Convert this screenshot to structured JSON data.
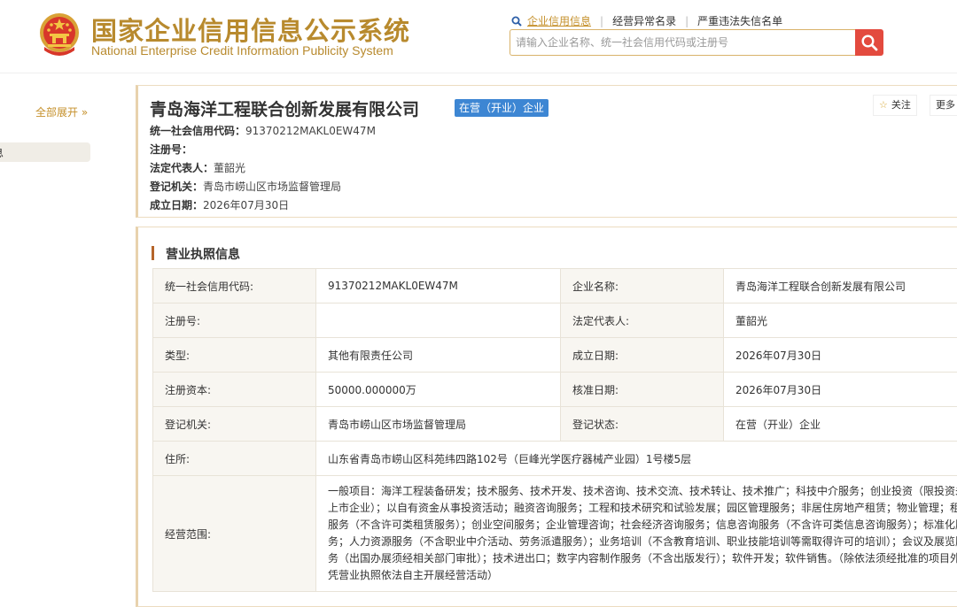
{
  "header": {
    "logo_cn": "国家企业信用信息公示系统",
    "logo_en": "National Enterprise Credit Information Publicity System",
    "links": [
      "企业信用信息",
      "经营异常名录",
      "严重违法失信名单"
    ],
    "search_placeholder": "请输入企业名称、统一社会信用代码或注册号",
    "accent_color": "#c5902b",
    "search_button_color": "#e34a3e"
  },
  "sidebar": {
    "expand_label": "全部展开 »",
    "items": [
      "息",
      "",
      ""
    ]
  },
  "company": {
    "name": "青岛海洋工程联合创新发展有限公司",
    "status_badge": "在营（开业）企业",
    "rows": [
      {
        "label": "统一社会信用代码：",
        "value": "91370212MAKL0EW47M"
      },
      {
        "label": "注册号：",
        "value": ""
      },
      {
        "label": "法定代表人：",
        "value": "董韶光"
      },
      {
        "label": "登记机关：",
        "value": "青岛市崂山区市场监督管理局"
      },
      {
        "label": "成立日期：",
        "value": "2026年07月30日"
      }
    ],
    "follow_label": "关注",
    "more_label": "更多"
  },
  "license": {
    "title": "营业执照信息",
    "rows": [
      {
        "l1": "统一社会信用代码:",
        "v1": "91370212MAKL0EW47M",
        "l2": "企业名称:",
        "v2": "青岛海洋工程联合创新发展有限公司"
      },
      {
        "l1": "注册号:",
        "v1": "",
        "l2": "法定代表人:",
        "v2": "董韶光"
      },
      {
        "l1": "类型:",
        "v1": "其他有限责任公司",
        "l2": "成立日期:",
        "v2": "2026年07月30日"
      },
      {
        "l1": "注册资本:",
        "v1": "50000.000000万",
        "l2": "核准日期:",
        "v2": "2026年07月30日"
      },
      {
        "l1": "登记机关:",
        "v1": "青岛市崂山区市场监督管理局",
        "l2": "登记状态:",
        "v2": "在营（开业）企业"
      }
    ],
    "address_label": "住所:",
    "address_value": "山东省青岛市崂山区科苑纬四路102号（巨峰光学医疗器械产业园）1号楼5层",
    "scope_label": "经营范围:",
    "scope_value": "一般项目：海洋工程装备研发；技术服务、技术开发、技术咨询、技术交流、技术转让、技术推广；科技中介服务；创业投资（限投资未上市企业）；以自有资金从事投资活动；融资咨询服务；工程和技术研究和试验发展；园区管理服务；非居住房地产租赁；物业管理；租赁服务（不含许可类租赁服务）；创业空间服务；企业管理咨询；社会经济咨询服务；信息咨询服务（不含许可类信息咨询服务）；标准化服务；人力资源服务（不含职业中介活动、劳务派遣服务）；业务培训（不含教育培训、职业技能培训等需取得许可的培训）；会议及展览服务（出国办展须经相关部门审批）；技术进出口；数字内容制作服务（不含出版发行）；软件开发；软件销售。（除依法须经批准的项目外，凭营业执照依法自主开展经营活动）"
  }
}
